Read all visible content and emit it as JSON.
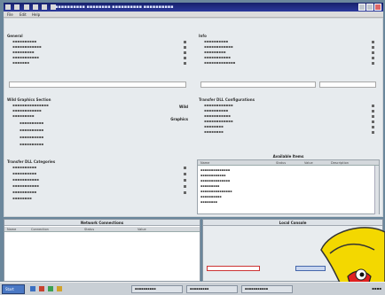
{
  "window": {
    "title": "▪▪▪▪▪▪▪▪▪▪ ▪▪▪▪▪▪▪▪ ▪▪▪▪▪▪▪▪▪▪ ▪▪▪▪▪▪▪▪▪▪"
  },
  "menu": [
    "File",
    "Edit",
    "Help"
  ],
  "left_top": {
    "title": "General",
    "rows": [
      "▪▪▪▪▪▪▪▪▪▪",
      "▪▪▪▪▪▪▪▪▪▪▪▪",
      "▪▪▪▪▪▪▪▪▪",
      "▪▪▪▪▪▪▪▪▪▪▪",
      "▪▪▪▪▪▪▪"
    ]
  },
  "right_top": {
    "title": "Info",
    "rows": [
      "▪▪▪▪▪▪▪▪▪▪",
      "▪▪▪▪▪▪▪▪▪▪▪▪",
      "▪▪▪▪▪▪▪▪▪",
      "▪▪▪▪▪▪▪▪▪▪▪",
      "▪▪▪▪▪▪▪▪▪▪▪▪▪"
    ]
  },
  "left_mid": {
    "title": "Wild Graphics Section",
    "rows": [
      "▪▪▪▪▪▪▪▪▪▪▪▪▪▪▪",
      "▪▪▪▪▪▪▪▪▪▪▪▪",
      "▪▪▪▪▪▪▪▪▪",
      "▪▪▪▪▪▪▪▪▪▪",
      "▪▪▪▪▪▪▪▪▪▪",
      "▪▪▪▪▪▪▪▪▪▪",
      "▪▪▪▪▪▪▪▪▪▪"
    ],
    "badge1": "Wild",
    "badge2": "Graphics"
  },
  "right_mid": {
    "title": "Transfer DLL Configurations",
    "rows": [
      "▪▪▪▪▪▪▪▪▪▪▪▪",
      "▪▪▪▪▪▪▪▪▪▪",
      "▪▪▪▪▪▪▪▪▪▪▪",
      "▪▪▪▪▪▪▪▪▪▪▪▪",
      "▪▪▪▪▪▪▪▪",
      "▪▪▪▪▪▪▪▪"
    ]
  },
  "left_bot": {
    "title": "Transfer DLL Categories",
    "rows": [
      "▪▪▪▪▪▪▪▪▪▪",
      "▪▪▪▪▪▪▪▪▪▪",
      "▪▪▪▪▪▪▪▪▪▪▪",
      "▪▪▪▪▪▪▪▪▪▪▪",
      "▪▪▪▪▪▪▪▪▪▪",
      "▪▪▪▪▪▪▪▪"
    ]
  },
  "table": {
    "title": "Available Items",
    "columns": [
      "Name",
      "Status",
      "Value",
      "Description"
    ],
    "rows": [
      "▪▪▪▪▪▪▪▪▪▪▪▪▪▪",
      "▪▪▪▪▪▪▪▪▪▪▪▪",
      "▪▪▪▪▪▪▪▪▪▪▪▪▪▪",
      "▪▪▪▪▪▪▪▪▪",
      "▪▪▪▪▪▪▪▪▪▪▪▪▪▪▪",
      "▪▪▪▪▪▪▪▪▪▪",
      "▪▪▪▪▪▪▪▪"
    ]
  },
  "bottom_left": {
    "title": "Network Connections",
    "columns": [
      "Name",
      "Connection",
      "Status",
      "Value"
    ]
  },
  "bottom_right": {
    "title": "Local Console"
  },
  "taskbar": {
    "start": "Start",
    "items": [
      "▪▪▪▪▪▪▪▪▪▪",
      "▪▪▪▪▪▪▪▪▪",
      "▪▪▪▪▪▪▪▪▪▪▪"
    ],
    "clock": "▪▪▪▪"
  },
  "colors": {
    "titlebar": "#1c2a8a",
    "panel": "#e7ebee",
    "desktop": "#6b879c",
    "mascot": "#f3d800"
  }
}
